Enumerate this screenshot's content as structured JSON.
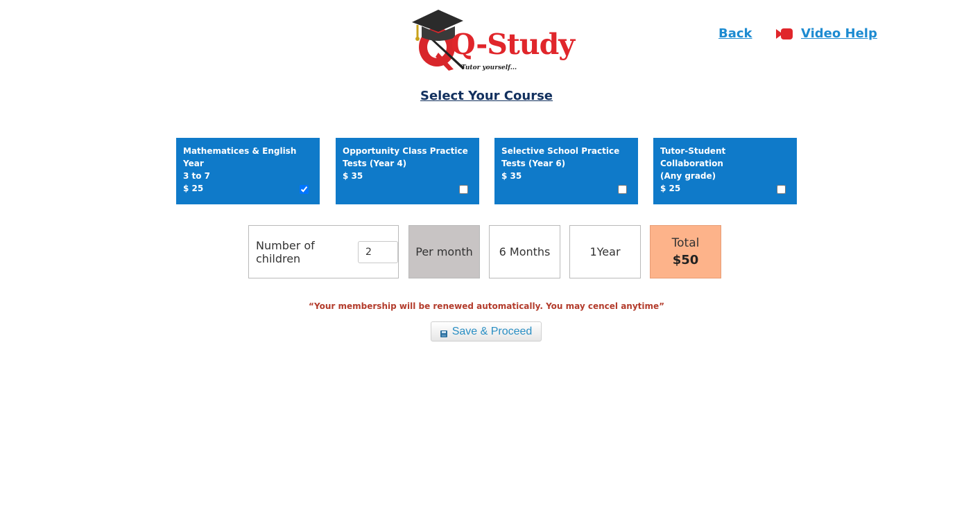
{
  "header": {
    "logo_text": "Q-Study",
    "logo_tagline": "Tutor yourself...",
    "back_label": "Back",
    "video_help_label": "Video Help",
    "video_icon": "video-camera-icon"
  },
  "page_title": "Select Your Course",
  "courses": [
    {
      "name": "Mathematices & English Year\n3 to 7",
      "price": "$ 25",
      "checked": true
    },
    {
      "name": "Opportunity Class Practice\nTests (Year 4)",
      "price": "$ 35",
      "checked": false
    },
    {
      "name": "Selective School Practice\nTests (Year 6)",
      "price": "$ 35",
      "checked": false
    },
    {
      "name": "Tutor-Student Collaboration\n(Any grade)",
      "price": "$ 25",
      "checked": false
    }
  ],
  "plan": {
    "children_label": "Number of children",
    "children_value": "2",
    "per_month_label": "Per month",
    "six_months_label": "6 Months",
    "one_year_label": "1Year",
    "selected_period": "Per month",
    "total_label": "Total",
    "total_value": "$50"
  },
  "notice": "“Your membership will be renewed automatically. You may cencel anytime”",
  "save_button": {
    "label": "Save & Proceed",
    "icon": "save-disk-icon"
  },
  "colors": {
    "course_card_bg": "#0f7ac9",
    "link": "#1d8bd1",
    "title": "#12305e",
    "selected_period_bg": "#c8c4c4",
    "total_bg": "#fdb38a",
    "notice": "#b33c2c",
    "logo_red": "#e0262b"
  }
}
